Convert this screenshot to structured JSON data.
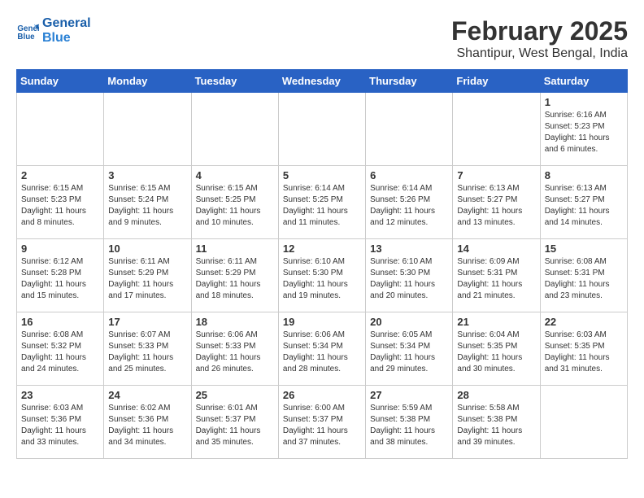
{
  "logo": {
    "line1": "General",
    "line2": "Blue"
  },
  "title": "February 2025",
  "subtitle": "Shantipur, West Bengal, India",
  "weekdays": [
    "Sunday",
    "Monday",
    "Tuesday",
    "Wednesday",
    "Thursday",
    "Friday",
    "Saturday"
  ],
  "weeks": [
    [
      {
        "day": "",
        "info": ""
      },
      {
        "day": "",
        "info": ""
      },
      {
        "day": "",
        "info": ""
      },
      {
        "day": "",
        "info": ""
      },
      {
        "day": "",
        "info": ""
      },
      {
        "day": "",
        "info": ""
      },
      {
        "day": "1",
        "info": "Sunrise: 6:16 AM\nSunset: 5:23 PM\nDaylight: 11 hours and 6 minutes."
      }
    ],
    [
      {
        "day": "2",
        "info": "Sunrise: 6:15 AM\nSunset: 5:23 PM\nDaylight: 11 hours and 8 minutes."
      },
      {
        "day": "3",
        "info": "Sunrise: 6:15 AM\nSunset: 5:24 PM\nDaylight: 11 hours and 9 minutes."
      },
      {
        "day": "4",
        "info": "Sunrise: 6:15 AM\nSunset: 5:25 PM\nDaylight: 11 hours and 10 minutes."
      },
      {
        "day": "5",
        "info": "Sunrise: 6:14 AM\nSunset: 5:25 PM\nDaylight: 11 hours and 11 minutes."
      },
      {
        "day": "6",
        "info": "Sunrise: 6:14 AM\nSunset: 5:26 PM\nDaylight: 11 hours and 12 minutes."
      },
      {
        "day": "7",
        "info": "Sunrise: 6:13 AM\nSunset: 5:27 PM\nDaylight: 11 hours and 13 minutes."
      },
      {
        "day": "8",
        "info": "Sunrise: 6:13 AM\nSunset: 5:27 PM\nDaylight: 11 hours and 14 minutes."
      }
    ],
    [
      {
        "day": "9",
        "info": "Sunrise: 6:12 AM\nSunset: 5:28 PM\nDaylight: 11 hours and 15 minutes."
      },
      {
        "day": "10",
        "info": "Sunrise: 6:11 AM\nSunset: 5:29 PM\nDaylight: 11 hours and 17 minutes."
      },
      {
        "day": "11",
        "info": "Sunrise: 6:11 AM\nSunset: 5:29 PM\nDaylight: 11 hours and 18 minutes."
      },
      {
        "day": "12",
        "info": "Sunrise: 6:10 AM\nSunset: 5:30 PM\nDaylight: 11 hours and 19 minutes."
      },
      {
        "day": "13",
        "info": "Sunrise: 6:10 AM\nSunset: 5:30 PM\nDaylight: 11 hours and 20 minutes."
      },
      {
        "day": "14",
        "info": "Sunrise: 6:09 AM\nSunset: 5:31 PM\nDaylight: 11 hours and 21 minutes."
      },
      {
        "day": "15",
        "info": "Sunrise: 6:08 AM\nSunset: 5:31 PM\nDaylight: 11 hours and 23 minutes."
      }
    ],
    [
      {
        "day": "16",
        "info": "Sunrise: 6:08 AM\nSunset: 5:32 PM\nDaylight: 11 hours and 24 minutes."
      },
      {
        "day": "17",
        "info": "Sunrise: 6:07 AM\nSunset: 5:33 PM\nDaylight: 11 hours and 25 minutes."
      },
      {
        "day": "18",
        "info": "Sunrise: 6:06 AM\nSunset: 5:33 PM\nDaylight: 11 hours and 26 minutes."
      },
      {
        "day": "19",
        "info": "Sunrise: 6:06 AM\nSunset: 5:34 PM\nDaylight: 11 hours and 28 minutes."
      },
      {
        "day": "20",
        "info": "Sunrise: 6:05 AM\nSunset: 5:34 PM\nDaylight: 11 hours and 29 minutes."
      },
      {
        "day": "21",
        "info": "Sunrise: 6:04 AM\nSunset: 5:35 PM\nDaylight: 11 hours and 30 minutes."
      },
      {
        "day": "22",
        "info": "Sunrise: 6:03 AM\nSunset: 5:35 PM\nDaylight: 11 hours and 31 minutes."
      }
    ],
    [
      {
        "day": "23",
        "info": "Sunrise: 6:03 AM\nSunset: 5:36 PM\nDaylight: 11 hours and 33 minutes."
      },
      {
        "day": "24",
        "info": "Sunrise: 6:02 AM\nSunset: 5:36 PM\nDaylight: 11 hours and 34 minutes."
      },
      {
        "day": "25",
        "info": "Sunrise: 6:01 AM\nSunset: 5:37 PM\nDaylight: 11 hours and 35 minutes."
      },
      {
        "day": "26",
        "info": "Sunrise: 6:00 AM\nSunset: 5:37 PM\nDaylight: 11 hours and 37 minutes."
      },
      {
        "day": "27",
        "info": "Sunrise: 5:59 AM\nSunset: 5:38 PM\nDaylight: 11 hours and 38 minutes."
      },
      {
        "day": "28",
        "info": "Sunrise: 5:58 AM\nSunset: 5:38 PM\nDaylight: 11 hours and 39 minutes."
      },
      {
        "day": "",
        "info": ""
      }
    ]
  ]
}
